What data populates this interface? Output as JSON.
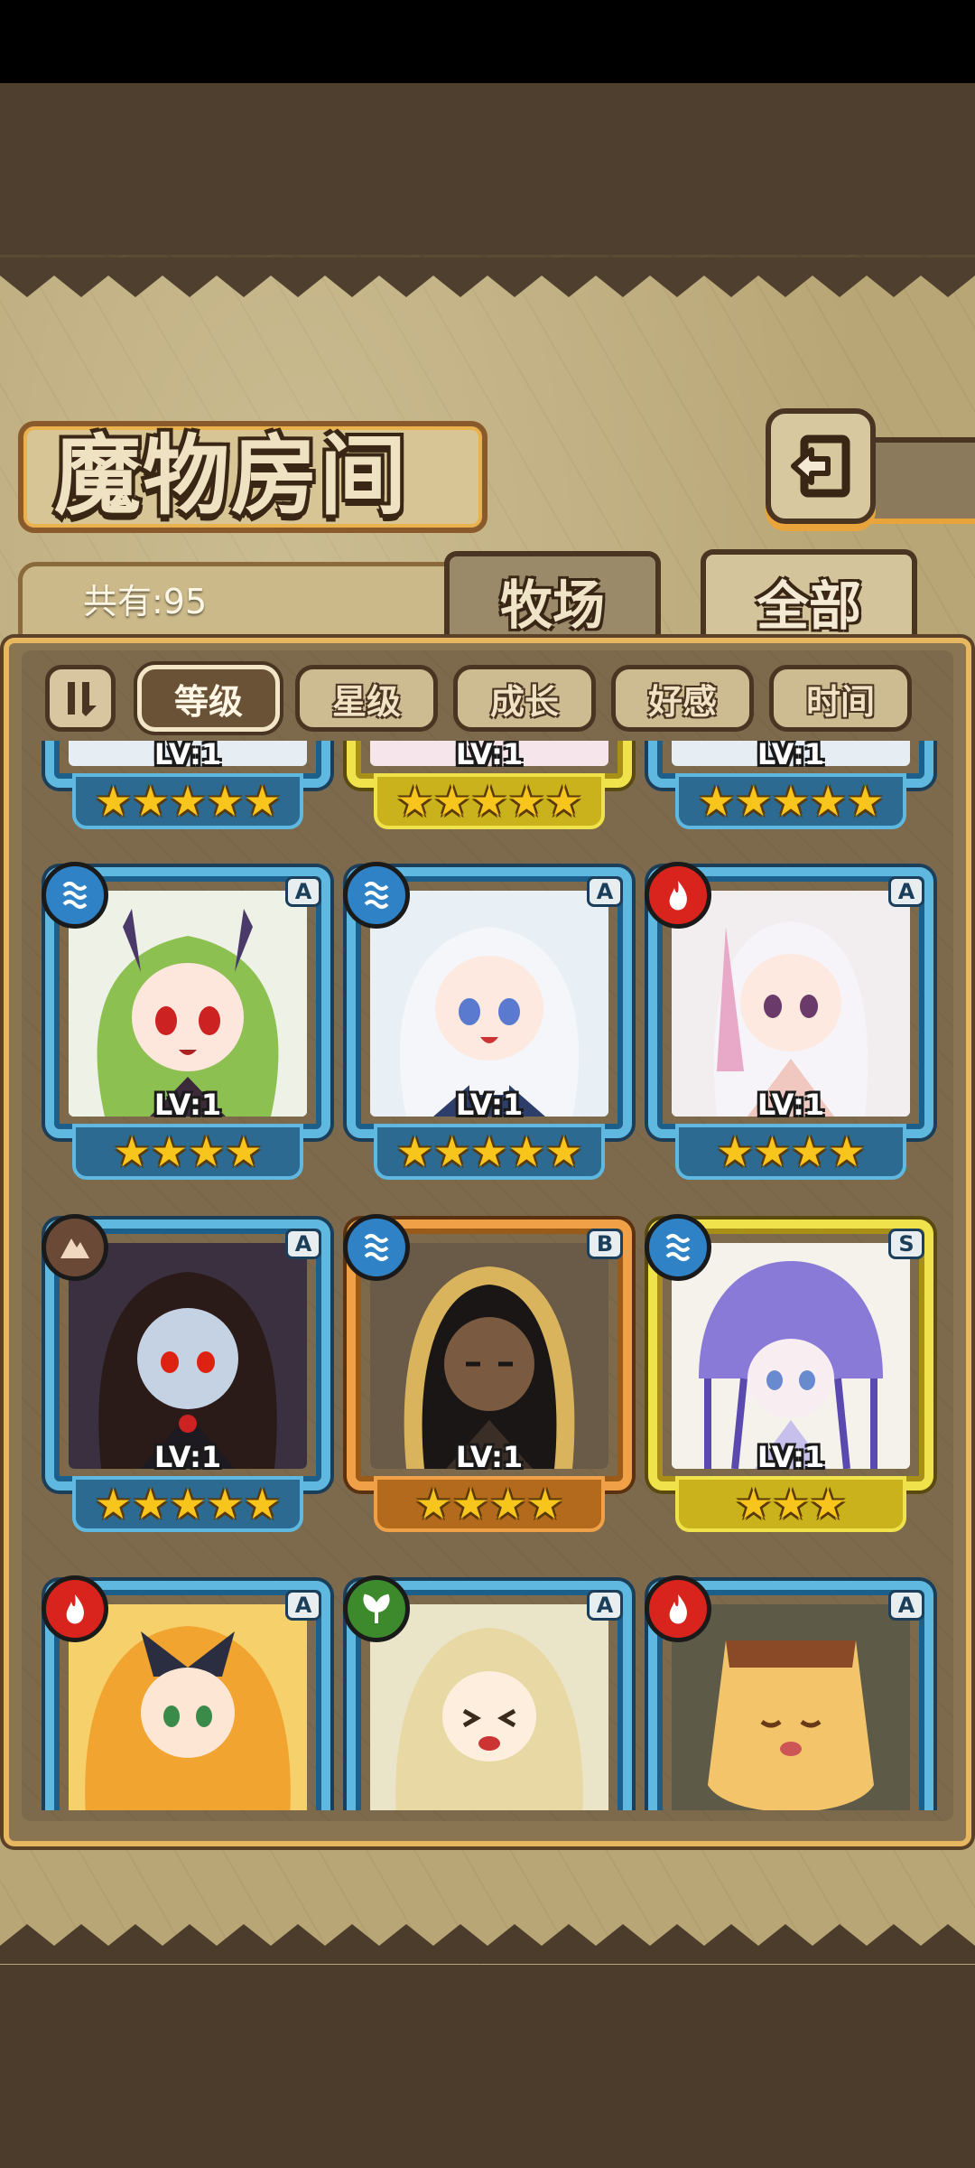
{
  "screen": {
    "title": "魔物房间",
    "count_label": "共有:95",
    "tabs": [
      {
        "label": "牧场",
        "active": false
      },
      {
        "label": "全部",
        "active": true
      }
    ],
    "sort_buttons": [
      {
        "label": "等级",
        "active": true
      },
      {
        "label": "星级",
        "active": false
      },
      {
        "label": "成长",
        "active": false
      },
      {
        "label": "好感",
        "active": false
      },
      {
        "label": "时间",
        "active": false
      }
    ]
  },
  "monsters_partial_top": [
    {
      "level": "LV:1",
      "stars": "★★★★★",
      "frame": "blue"
    },
    {
      "level": "LV:1",
      "stars": "★★★★★",
      "frame": "gold"
    },
    {
      "level": "LV:1",
      "stars": "★★★★★",
      "frame": "blue"
    }
  ],
  "monsters": [
    {
      "element": "water",
      "rank": "A",
      "level": "LV:1",
      "stars": "★★★★",
      "frame": "blue",
      "palette": "green-horn"
    },
    {
      "element": "water",
      "rank": "A",
      "level": "LV:1",
      "stars": "★★★★★",
      "frame": "blue",
      "palette": "white-maid"
    },
    {
      "element": "fire",
      "rank": "A",
      "level": "LV:1",
      "stars": "★★★★",
      "frame": "blue",
      "palette": "pink-white"
    },
    {
      "element": "earth",
      "rank": "A",
      "level": "LV:1",
      "stars": "★★★★★",
      "frame": "blue",
      "palette": "dark-vampire"
    },
    {
      "element": "water",
      "rank": "B",
      "level": "LV:1",
      "stars": "★★★★",
      "frame": "bronze",
      "palette": "egyptian"
    },
    {
      "element": "water",
      "rank": "S",
      "level": "LV:1",
      "stars": "★★★",
      "frame": "gold",
      "palette": "jellyfish"
    },
    {
      "element": "fire",
      "rank": "A",
      "level": "",
      "stars": "",
      "frame": "blue",
      "palette": "lightning"
    },
    {
      "element": "wood",
      "rank": "A",
      "level": "",
      "stars": "",
      "frame": "blue",
      "palette": "fairy"
    },
    {
      "element": "fire",
      "rank": "A",
      "level": "",
      "stars": "",
      "frame": "blue",
      "palette": "pudding"
    }
  ],
  "colors": {
    "frame_blue": "#5fb8e0",
    "frame_gold": "#f0e24a",
    "frame_bronze": "#f0a046",
    "star": "#f7c51c",
    "panel_border": "#e7b860"
  }
}
